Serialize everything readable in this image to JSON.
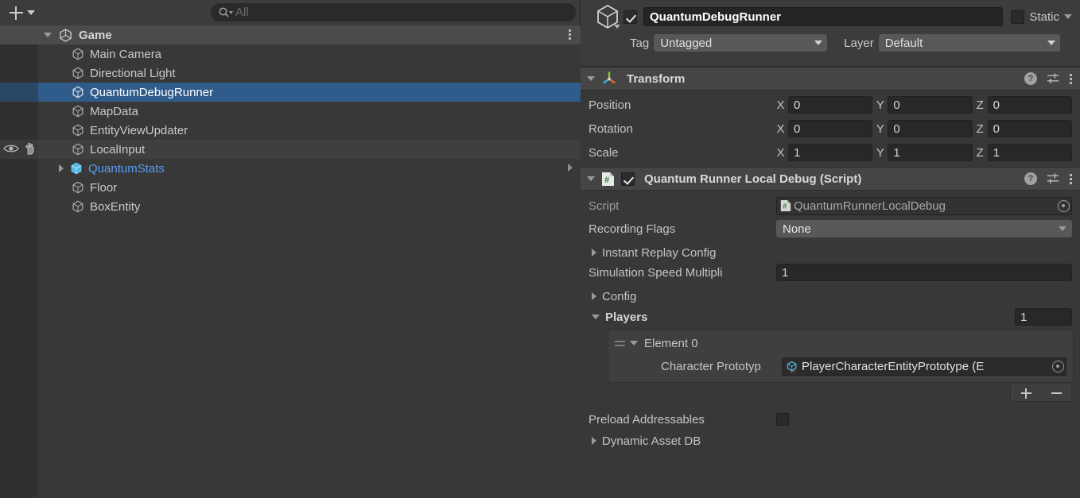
{
  "hierarchy": {
    "toolbar": {
      "add_button_label": "+",
      "add_dropdown_icon": "chevron-down-icon",
      "search_icon": "search-icon",
      "search_placeholder": "All",
      "search_value": ""
    },
    "scene": {
      "name": "Game",
      "icon": "unity-scene-icon",
      "expanded": true,
      "menu_icon": "kebab-menu-icon"
    },
    "items": [
      {
        "label": "Main Camera",
        "icon": "gameobject-icon",
        "prefab": false,
        "expandable": false,
        "state": "normal"
      },
      {
        "label": "Directional Light",
        "icon": "gameobject-icon",
        "prefab": false,
        "expandable": false,
        "state": "normal"
      },
      {
        "label": "QuantumDebugRunner",
        "icon": "gameobject-icon",
        "prefab": false,
        "expandable": false,
        "state": "selected"
      },
      {
        "label": "MapData",
        "icon": "gameobject-icon",
        "prefab": false,
        "expandable": false,
        "state": "normal"
      },
      {
        "label": "EntityViewUpdater",
        "icon": "gameobject-icon",
        "prefab": false,
        "expandable": false,
        "state": "normal"
      },
      {
        "label": "LocalInput",
        "icon": "gameobject-icon",
        "prefab": false,
        "expandable": false,
        "state": "hovered"
      },
      {
        "label": "QuantumStats",
        "icon": "prefab-icon",
        "prefab": true,
        "expandable": true,
        "state": "normal"
      },
      {
        "label": "Floor",
        "icon": "gameobject-icon",
        "prefab": false,
        "expandable": false,
        "state": "normal"
      },
      {
        "label": "BoxEntity",
        "icon": "gameobject-icon",
        "prefab": false,
        "expandable": false,
        "state": "normal"
      }
    ]
  },
  "inspector": {
    "header": {
      "gameobject_icon": "gameobject-icon",
      "enabled": true,
      "name": "QuantumDebugRunner",
      "static_label": "Static",
      "static_checked": false,
      "tag_label": "Tag",
      "tag_value": "Untagged",
      "layer_label": "Layer",
      "layer_value": "Default"
    },
    "transform": {
      "title": "Transform",
      "icon": "transform-gizmo-icon",
      "expanded": true,
      "help_icon": "help-icon",
      "preset_icon": "preset-settings-icon",
      "menu_icon": "kebab-menu-icon",
      "rows": [
        {
          "label": "Position",
          "x": "0",
          "y": "0",
          "z": "0"
        },
        {
          "label": "Rotation",
          "x": "0",
          "y": "0",
          "z": "0"
        },
        {
          "label": "Scale",
          "x": "1",
          "y": "1",
          "z": "1"
        }
      ],
      "axis_labels": {
        "x": "X",
        "y": "Y",
        "z": "Z"
      }
    },
    "script_component": {
      "title": "Quantum Runner Local Debug (Script)",
      "icon": "csharp-script-icon",
      "enabled": true,
      "expanded": true,
      "help_icon": "help-icon",
      "preset_icon": "preset-settings-icon",
      "menu_icon": "kebab-menu-icon",
      "script_label": "Script",
      "script_value": "QuantumRunnerLocalDebug",
      "script_icon": "csharp-script-icon",
      "script_select_icon": "object-picker-icon",
      "recording_flags_label": "Recording Flags",
      "recording_flags_value": "None",
      "instant_replay_label": "Instant Replay Config",
      "instant_replay_expanded": false,
      "sim_speed_label": "Simulation Speed Multipli",
      "sim_speed_value": "1",
      "config_label": "Config",
      "config_expanded": false,
      "players_label": "Players",
      "players_expanded": true,
      "players_count": "1",
      "element_label": "Element 0",
      "element_expanded": true,
      "element_drag_icon": "drag-handle-icon",
      "character_prototype_label": "Character Prototyp",
      "character_prototype_value": "PlayerCharacterEntityPrototype (E",
      "character_prototype_icon": "entity-prototype-icon",
      "character_prototype_select_icon": "object-picker-icon",
      "list_add_label": "+",
      "list_remove_label": "–",
      "preload_addressables_label": "Preload Addressables",
      "preload_addressables_checked": false,
      "dynamic_asset_db_label": "Dynamic Asset DB",
      "dynamic_asset_db_expanded": false
    }
  },
  "colors": {
    "background": "#383838",
    "panel_header": "#3c3c3c",
    "selection_blue": "#2f5c8b",
    "prefab_blue": "#5a9bf3",
    "component_header": "#454545",
    "field_dark": "#282828",
    "dropdown_grey": "#585858",
    "gutter": "#303030"
  }
}
